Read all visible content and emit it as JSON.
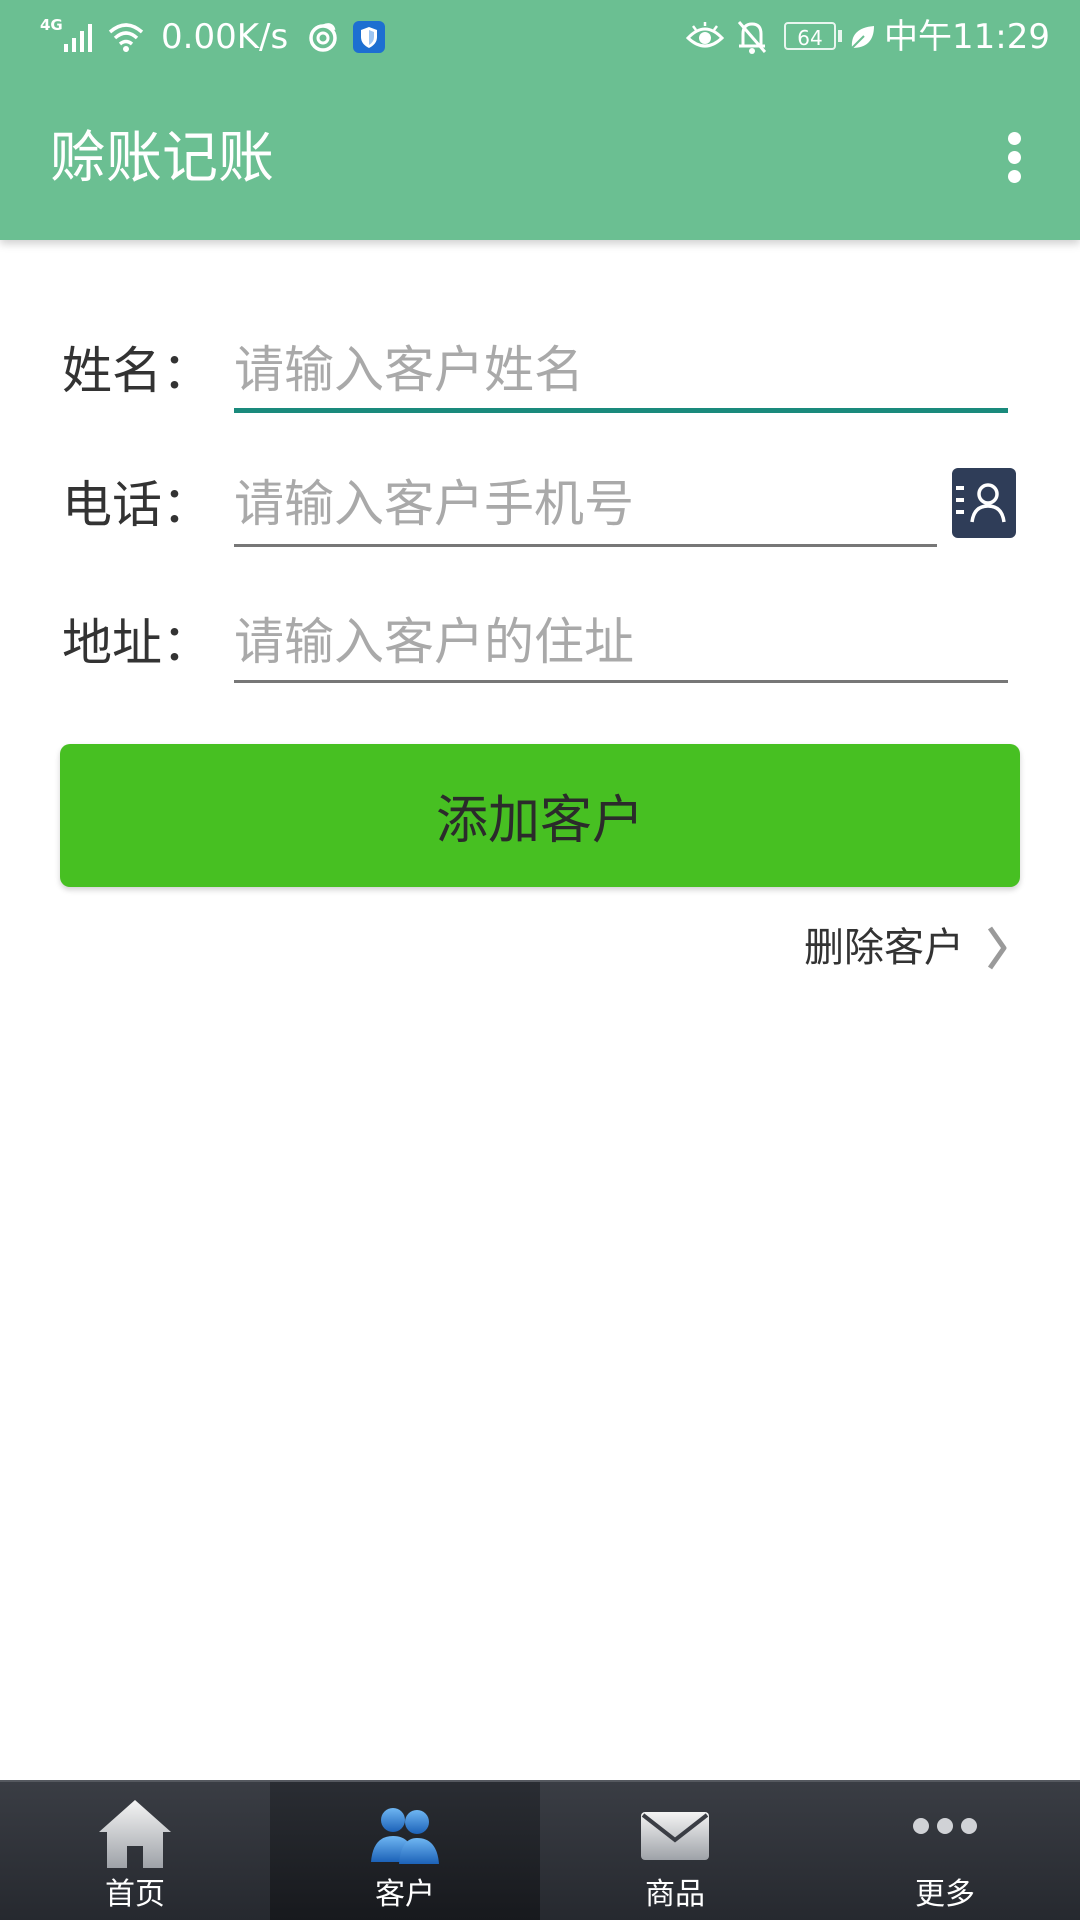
{
  "status_bar": {
    "network_type": "4G",
    "net_speed": "0.00K/s",
    "battery_level": "64",
    "time": "中午11:29",
    "icons": [
      "signal-icon",
      "wifi-icon",
      "swirl-app-icon",
      "shield-app-icon",
      "eye-comfort-icon",
      "notifications-off-icon",
      "battery-icon",
      "power-saving-leaf-icon"
    ]
  },
  "app_bar": {
    "title": "赊账记账",
    "menu_icon": "more-vertical-icon",
    "color": "#6bbf92"
  },
  "form": {
    "name": {
      "label": "姓名：",
      "placeholder": "请输入客户姓名",
      "value": ""
    },
    "phone": {
      "label": "电话：",
      "placeholder": "请输入客户手机号",
      "value": "",
      "contact_icon": "contact-book-icon"
    },
    "address": {
      "label": "地址：",
      "placeholder": "请输入客户的住址",
      "value": ""
    }
  },
  "add_button": {
    "label": "添加客户",
    "color": "#47c022"
  },
  "delete_link": {
    "label": "删除客户",
    "icon": "chevron-right-icon"
  },
  "bottom_nav": {
    "active": "客户",
    "tabs": [
      {
        "label": "首页",
        "icon": "home-icon"
      },
      {
        "label": "客户",
        "icon": "customers-icon"
      },
      {
        "label": "商品",
        "icon": "mail-icon"
      },
      {
        "label": "更多",
        "icon": "more-dots-icon"
      }
    ]
  },
  "colors": {
    "focus_underline": "#1a8a7c",
    "contact_button": "#2f3d58",
    "nav_background": "#2e3137"
  }
}
